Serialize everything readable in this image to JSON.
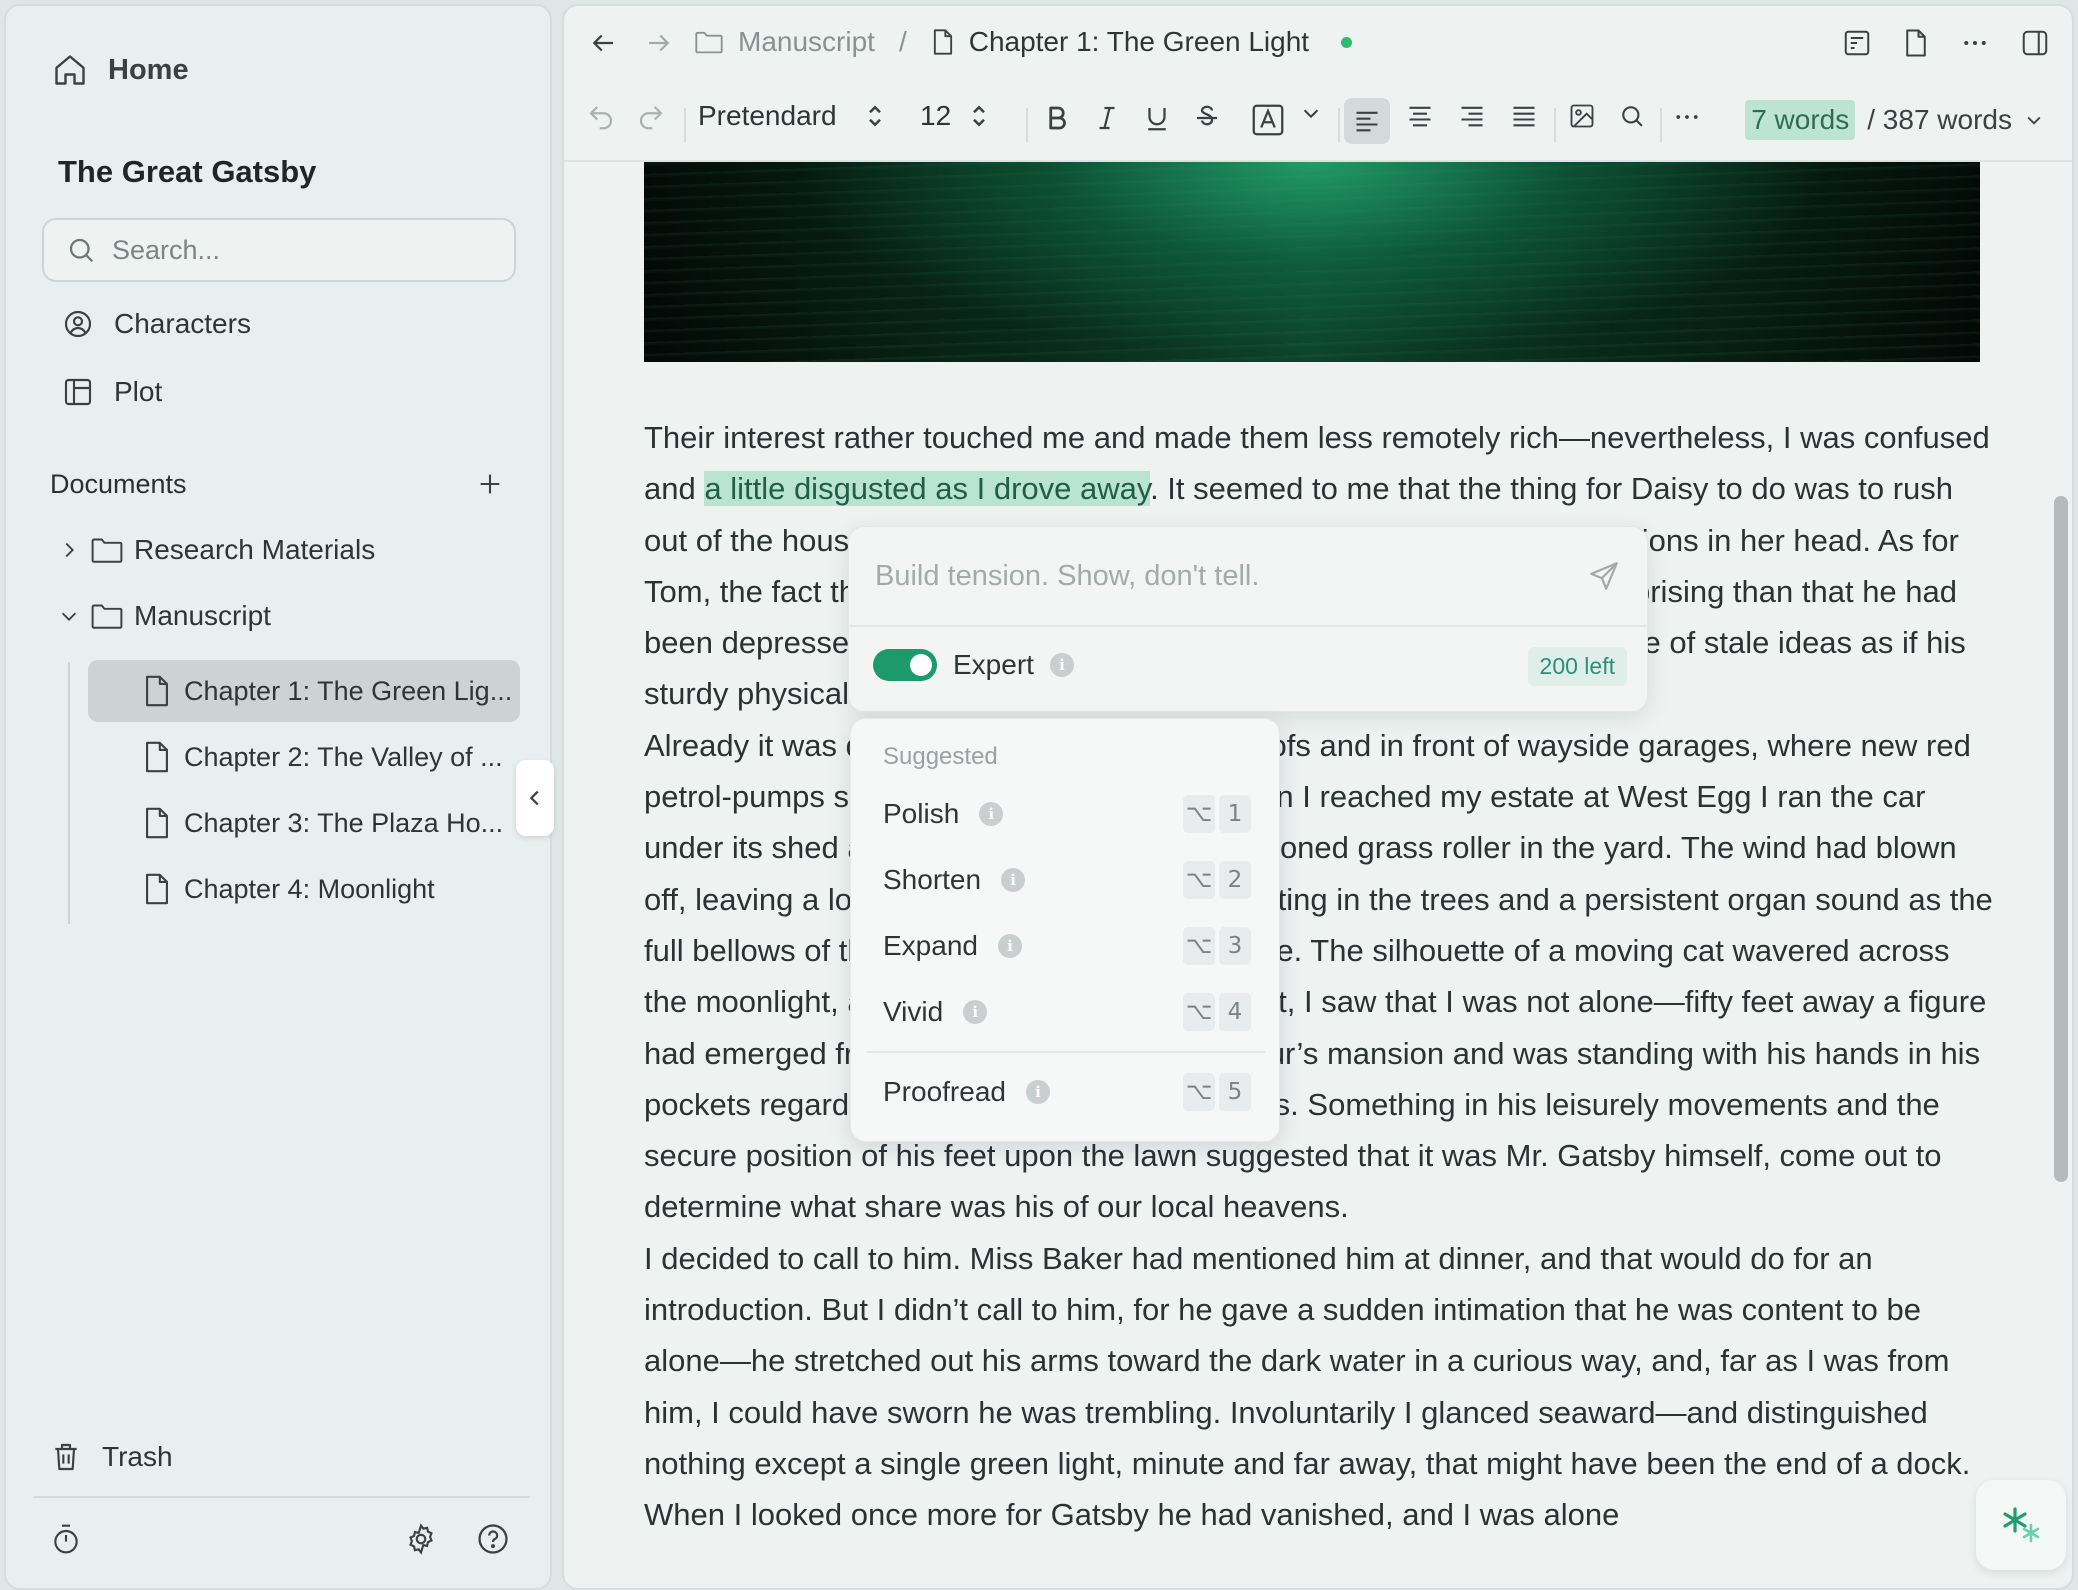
{
  "sidebar": {
    "home_label": "Home",
    "project_title": "The Great Gatsby",
    "search_placeholder": "Search...",
    "nav": {
      "characters": "Characters",
      "plot": "Plot"
    },
    "documents_label": "Documents",
    "folders": {
      "research": "Research Materials",
      "manuscript": "Manuscript"
    },
    "chapters": [
      "Chapter 1: The Green Lig...",
      "Chapter 2: The Valley of ...",
      "Chapter 3: The Plaza Ho...",
      "Chapter 4: Moonlight"
    ],
    "trash_label": "Trash"
  },
  "titlebar": {
    "folder": "Manuscript",
    "separator": "/",
    "document": "Chapter 1: The Green Light",
    "status_color": "#2dbb6c"
  },
  "toolbar": {
    "font": "Pretendard",
    "size": "12",
    "selected_words": "7 words",
    "total_words": "/ 387 words"
  },
  "document": {
    "p1_before": "Their interest rather touched me and made them less remotely rich—nevertheless, I was confused and ",
    "p1_highlight": "a little disgusted as I drove away",
    "p1_after": ". It seemed to me that the thing for Daisy to do was to rush out of the house, child in arms—but apparently there were no such intentions in her head. As for Tom, the fact that he “had some woman in New York” was really less surprising than that he had been depressed by a book. Something was making him nibble at the edge of stale ideas as if his sturdy physical egotism no longer nourished his peremptory heart.",
    "p2": "Already it was deep summer on roadhouse roofs and in front of wayside garages, where new red petrol-pumps sat out in pools of light, and when I reached my estate at West Egg I ran the car under its shed and sat for a while on an abandoned grass roller in the yard. The wind had blown off, leaving a loud, bright night, with wings beating in the trees and a persistent organ sound as the full bellows of the earth blew the frogs full of life. The silhouette of a moving cat wavered across the moonlight, and, turning my head to watch it, I saw that I was not alone—fifty feet away a figure had emerged from the shadow of my neighbour’s mansion and was standing with his hands in his pockets regarding the silver pepper of the stars. Something in his leisurely movements and the secure position of his feet upon the lawn suggested that it was Mr. Gatsby himself, come out to determine what share was his of our local heavens.",
    "p3": "I decided to call to him. Miss Baker had mentioned him at dinner, and that would do for an introduction. But I didn’t call to him, for he gave a sudden intimation that he was content to be alone—he stretched out his arms toward the dark water in a curious way, and, far as I was from him, I could have sworn he was trembling. Involuntarily I glanced seaward—and distinguished nothing except a single green light, minute and far away, that might have been the end of a dock. When I looked once more for Gatsby he had vanished, and I was alone"
  },
  "ai_panel": {
    "prompt_placeholder": "Build tension. Show, don't tell.",
    "expert_label": "Expert",
    "expert_enabled": true,
    "remaining": "200 left",
    "accent_color": "#1d9a6c"
  },
  "suggestions": {
    "title": "Suggested",
    "items": [
      {
        "label": "Polish",
        "modifier": "⌥",
        "key": "1"
      },
      {
        "label": "Shorten",
        "modifier": "⌥",
        "key": "2"
      },
      {
        "label": "Expand",
        "modifier": "⌥",
        "key": "3"
      },
      {
        "label": "Vivid",
        "modifier": "⌥",
        "key": "4"
      },
      {
        "label": "Proofread",
        "modifier": "⌥",
        "key": "5"
      }
    ]
  },
  "info_glyph": "i"
}
